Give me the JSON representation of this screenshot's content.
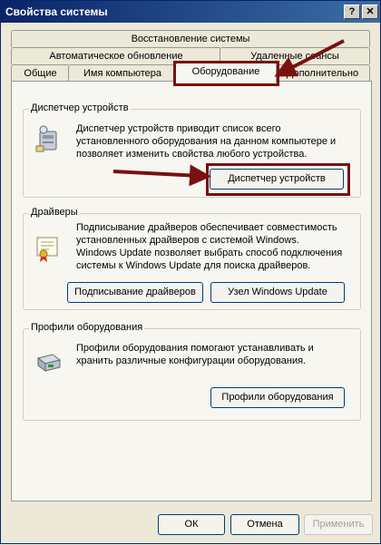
{
  "window": {
    "title": "Свойства системы",
    "help": "?",
    "close": "✕"
  },
  "tabs": {
    "row1": [
      "Восстановление системы"
    ],
    "row2": [
      "Автоматическое обновление",
      "Удаленные сеансы"
    ],
    "row3": [
      "Общие",
      "Имя компьютера",
      "Оборудование",
      "Дополнительно"
    ],
    "selected": "Оборудование"
  },
  "device_manager": {
    "label": "Диспетчер устройств",
    "text": [
      "Диспетчер устройств приводит список всего",
      "установленного оборудования на данном компьютере и",
      "позволяет изменить свойства любого устройства."
    ],
    "button": "Диспетчер устройств",
    "icon": "device-manager-icon"
  },
  "drivers": {
    "label": "Драйверы",
    "text": [
      "Подписывание драйверов обеспечивает совместимость",
      "установленных драйверов с системой Windows.",
      "Windows Update позволяет выбрать способ подключения",
      "системы к Windows Update для поиска драйверов."
    ],
    "sign_button": "Подписывание драйверов",
    "update_button": "Узел Windows Update",
    "icon": "certificate-icon"
  },
  "profiles": {
    "label": "Профили оборудования",
    "text": [
      "Профили оборудования помогают устанавливать и",
      "хранить различные конфигурации оборудования."
    ],
    "button": "Профили оборудования",
    "icon": "hardware-profile-icon"
  },
  "footer": {
    "ok": "ОК",
    "cancel": "Отмена",
    "apply": "Применить"
  },
  "colors": {
    "highlight": "#7a1010",
    "title_start": "#0a246a",
    "title_end": "#3a6ea5"
  }
}
